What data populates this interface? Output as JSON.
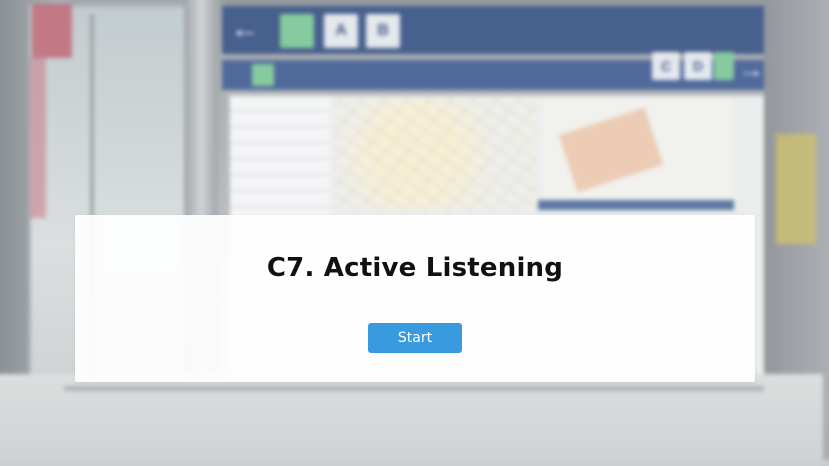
{
  "modal": {
    "title": "C7. Active Listening",
    "start_label": "Start"
  },
  "background": {
    "sign_letters": [
      "A",
      "B",
      "C",
      "D"
    ]
  },
  "colors": {
    "accent": "#3a9ae0",
    "title_text": "#111111",
    "card_bg": "#ffffff"
  }
}
